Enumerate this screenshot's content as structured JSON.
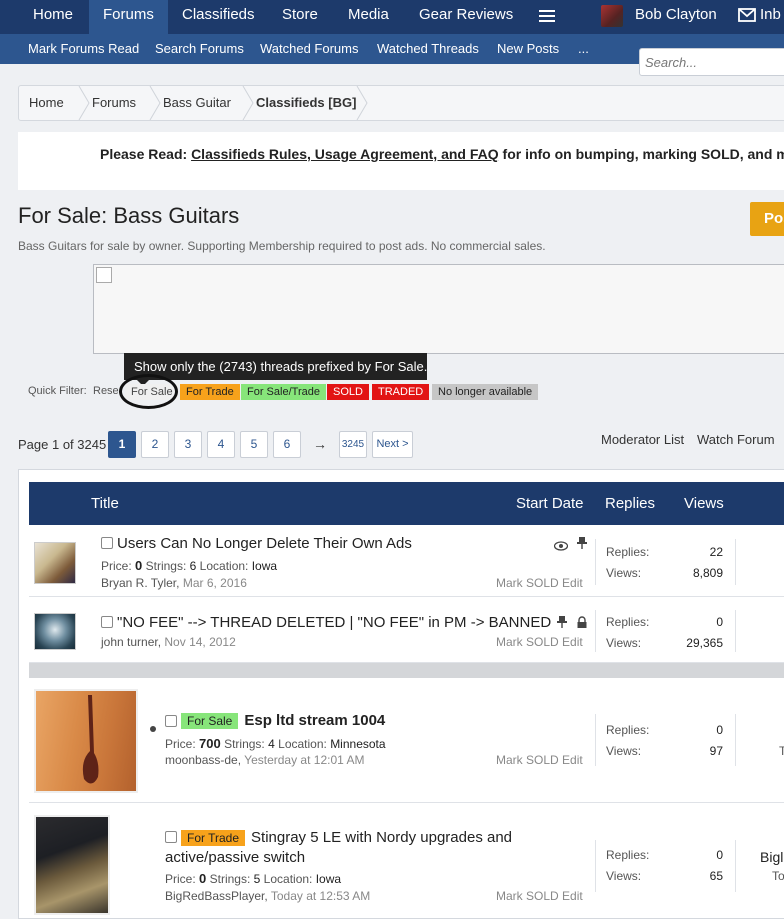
{
  "topnav": {
    "tabs": [
      {
        "label": "Home"
      },
      {
        "label": "Forums"
      },
      {
        "label": "Classifieds"
      },
      {
        "label": "Store"
      },
      {
        "label": "Media"
      },
      {
        "label": "Gear Reviews"
      }
    ],
    "user_name": "Bob Clayton",
    "inbox_label": "Inb"
  },
  "subnav": {
    "items": [
      "Mark Forums Read",
      "Search Forums",
      "Watched Forums",
      "Watched Threads",
      "New Posts",
      "..."
    ],
    "search_placeholder": "Search..."
  },
  "breadcrumb": [
    "Home",
    "Forums",
    "Bass Guitar",
    "Classifieds [BG]"
  ],
  "notice": {
    "prefix": "Please Read:",
    "link": "Classifieds Rules, Usage Agreement, and FAQ",
    "suffix": "for info on bumping, marking SOLD, and mor"
  },
  "page": {
    "title": "For Sale: Bass Guitars",
    "description": "Bass Guitars for sale by owner. Supporting Membership required to post ads. No commercial sales.",
    "post_button": "Pos"
  },
  "tooltip": "Show only the (2743) threads prefixed by For Sale.",
  "quick_filter": {
    "label": "Quick Filter:",
    "reset": "Rese",
    "pills": [
      "For Sale",
      "For Trade",
      "For Sale/Trade",
      "SOLD",
      "TRADED",
      "No longer available"
    ]
  },
  "pagination": {
    "info": "Page 1 of 3245",
    "pages": [
      "1",
      "2",
      "3",
      "4",
      "5",
      "6"
    ],
    "arrow": "→",
    "last": "3245",
    "next": "Next >",
    "moderator_list": "Moderator List",
    "watch_forum": "Watch Forum"
  },
  "list_header": {
    "title": "Title",
    "start_date": "Start Date",
    "replies": "Replies",
    "views": "Views"
  },
  "threads": [
    {
      "title": "Users Can No Longer Delete Their Own Ads",
      "price_label": "Price:",
      "price": "0",
      "strings_label": "Strings:",
      "strings": "6",
      "location_label": "Location:",
      "location": "Iowa",
      "starter": "Bryan R. Tyler,",
      "date": "Mar 6, 2016",
      "actions": "Mark SOLD Edit",
      "replies_label": "Replies:",
      "replies": "22",
      "views_label": "Views:",
      "views": "8,809"
    },
    {
      "title": "\"NO FEE\" --> THREAD DELETED | \"NO FEE\" in PM -> BANNED",
      "starter": "john turner,",
      "date": "Nov 14, 2012",
      "actions": "Mark SOLD Edit",
      "replies_label": "Replies:",
      "replies": "0",
      "views_label": "Views:",
      "views": "29,365"
    },
    {
      "prefix": "For Sale",
      "title": "Esp ltd stream 1004",
      "price_label": "Price:",
      "price": "700",
      "strings_label": "Strings:",
      "strings": "4",
      "location_label": "Location:",
      "location": "Minnesota",
      "starter": "moonbass-de,",
      "date": "Yesterday at 12:01 AM",
      "actions": "Mark SOLD Edit",
      "replies_label": "Replies:",
      "replies": "0",
      "views_label": "Views:",
      "views": "97",
      "last_col": "T"
    },
    {
      "prefix": "For Trade",
      "title": "Stingray 5 LE with Nordy upgrades and",
      "title_line2": "active/passive switch",
      "price_label": "Price:",
      "price": "0",
      "strings_label": "Strings:",
      "strings": "5",
      "location_label": "Location:",
      "location": "Iowa",
      "starter": "BigRedBassPlayer,",
      "date": "Today at 12:53 AM",
      "actions": "Mark SOLD Edit",
      "replies_label": "Replies:",
      "replies": "0",
      "views_label": "Views:",
      "views": "65",
      "last_col": "Bigl",
      "last_col2": "To"
    }
  ],
  "colors": {
    "nav_dark": "#1d3a6b",
    "nav_light": "#2d568f",
    "for_sale": "#87e57a",
    "for_trade": "#f7a21b",
    "sold": "#e21414",
    "post_button": "#e8a313"
  }
}
